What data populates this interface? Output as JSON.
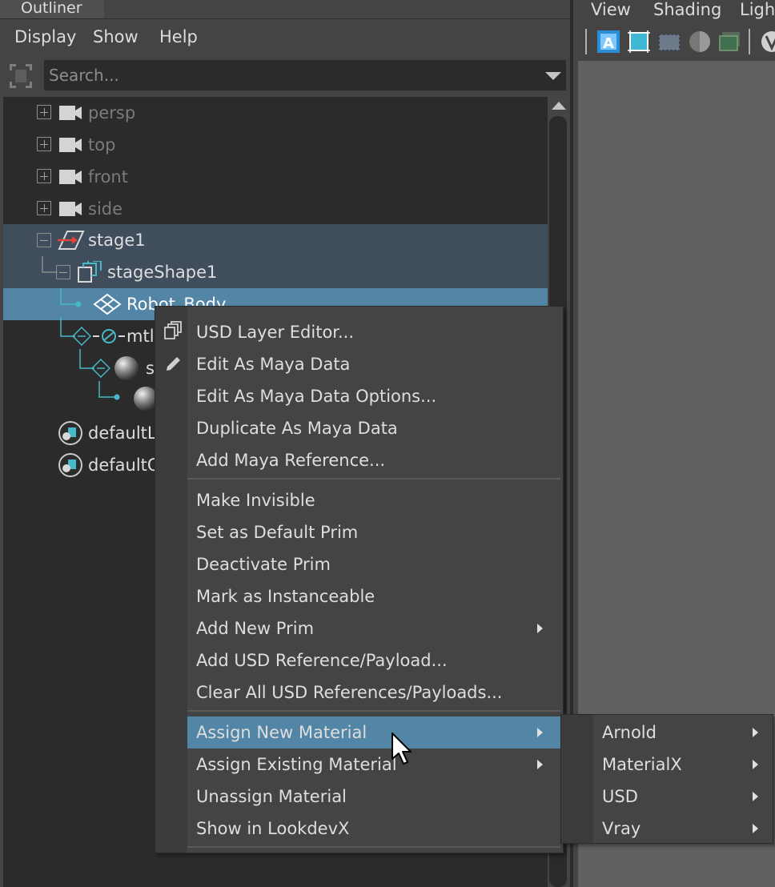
{
  "outliner": {
    "title": "Outliner",
    "menu": [
      "Display",
      "Show",
      "Help"
    ],
    "search_placeholder": "Search...",
    "tree": [
      {
        "label": "persp",
        "icon": "camera-icon"
      },
      {
        "label": "top",
        "icon": "camera-icon"
      },
      {
        "label": "front",
        "icon": "camera-icon"
      },
      {
        "label": "side",
        "icon": "camera-icon"
      },
      {
        "label": "stage1",
        "icon": "usd-stage-icon"
      },
      {
        "label": "stageShape1",
        "icon": "usd-proxy-shape-icon"
      },
      {
        "label": "Robot_Body",
        "icon": "mesh-prim-icon"
      },
      {
        "label": "mtl",
        "icon": "scope-icon"
      },
      {
        "label": "s",
        "icon": "material-sphere-icon"
      },
      {
        "label": "",
        "icon": "shader-sphere-icon"
      },
      {
        "label": "defaultLi",
        "icon": "light-set-icon"
      },
      {
        "label": "defaultO",
        "icon": "object-set-icon"
      }
    ]
  },
  "viewport": {
    "menu": [
      "View",
      "Shading",
      "Light"
    ]
  },
  "context_menu": {
    "groups": [
      [
        "USD Layer Editor...",
        "Edit As Maya Data",
        "Edit As Maya Data Options...",
        "Duplicate As Maya Data",
        "Add Maya Reference..."
      ],
      [
        "Make Invisible",
        "Set as Default Prim",
        "Deactivate Prim",
        "Mark as Instanceable",
        "Add New Prim",
        "Add USD Reference/Payload...",
        "Clear All USD References/Payloads..."
      ],
      [
        "Assign New Material",
        "Assign Existing Material",
        "Unassign Material",
        "Show in LookdevX"
      ]
    ],
    "highlighted": "Assign New Material"
  },
  "submenu": {
    "items": [
      "Arnold",
      "MaterialX",
      "USD",
      "Vray"
    ]
  },
  "colors": {
    "selection": "#5285a6",
    "selection_dark": "#3f4d5c",
    "tree_bg": "#2b2b2b",
    "accent_teal": "#46b8c8"
  }
}
